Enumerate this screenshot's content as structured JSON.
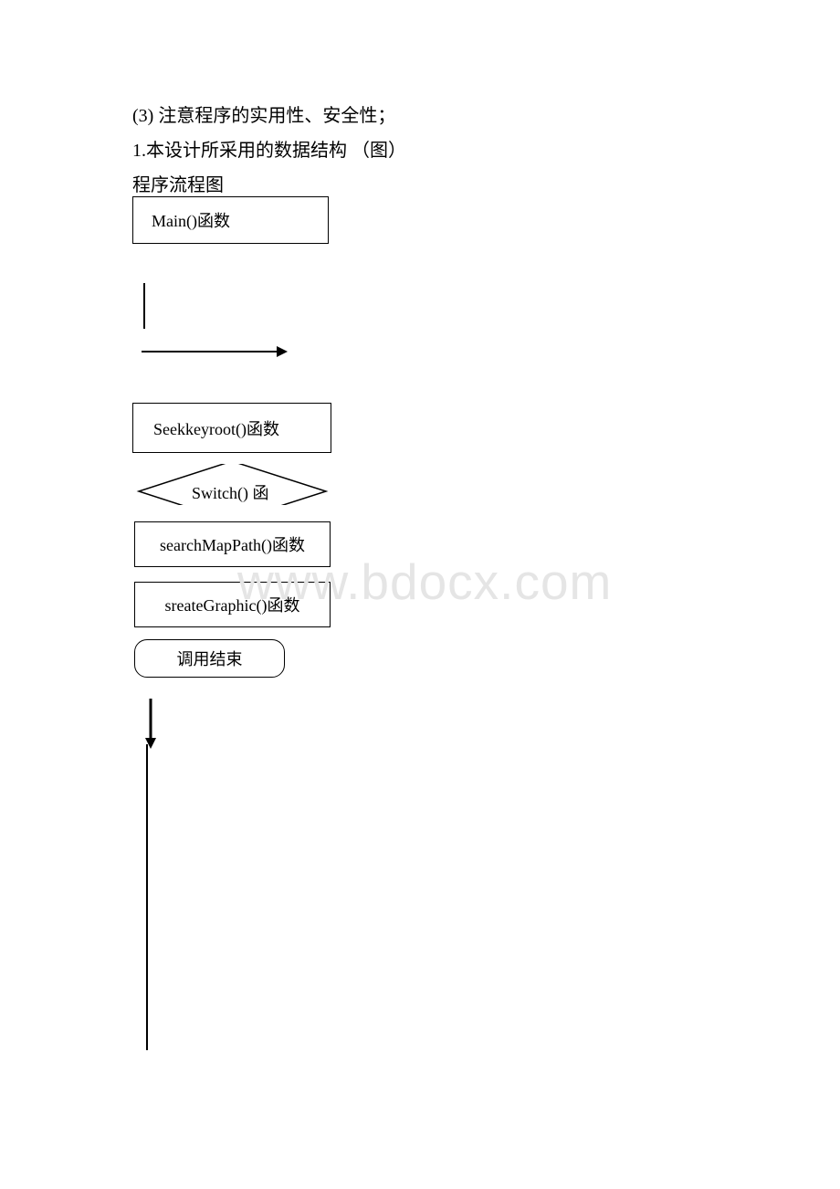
{
  "text": {
    "line1": "(3) 注意程序的实用性、安全性；",
    "line2": "1.本设计所采用的数据结构 （图）",
    "line3": "程序流程图"
  },
  "flowchart": {
    "nodes": {
      "main": "Main()函数",
      "seekkeyroot": "Seekkeyroot()函数",
      "switch_partial": "Switch()   函",
      "searchmappath": "searchMapPath()函数",
      "creategraphic": "sreateGraphic()函数",
      "end": "调用结束"
    }
  },
  "watermark": "www.bdocx.com"
}
